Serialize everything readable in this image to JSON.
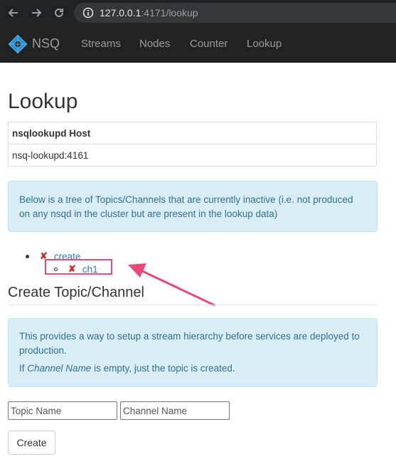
{
  "browser": {
    "url_host": "127.0.0.1",
    "url_rest": ":4171/lookup",
    "back_icon": "arrow-left-icon",
    "forward_icon": "arrow-right-icon",
    "reload_icon": "reload-icon",
    "info_icon": "info-icon"
  },
  "navbar": {
    "brand": "NSQ",
    "links": [
      "Streams",
      "Nodes",
      "Counter",
      "Lookup"
    ]
  },
  "page": {
    "title": "Lookup",
    "host_table": {
      "header": "nsqlookupd Host",
      "rows": [
        "nsq-lookupd:4161"
      ]
    },
    "inactive_alert": "Below is a tree of Topics/Channels that are currently inactive (i.e. not produced on any nsqd in the cluster but are present in the lookup data)",
    "tree": {
      "topic": "create",
      "channel": "ch1",
      "delete_mark": "✘"
    },
    "create_section": {
      "title": "Create Topic/Channel",
      "alert_line1": "This provides a way to setup a stream hierarchy before services are deployed to production.",
      "alert_line2_prefix": "If ",
      "alert_line2_em": "Channel Name",
      "alert_line2_suffix": " is empty, just the topic is created.",
      "topic_placeholder": "Topic Name",
      "channel_placeholder": "Channel Name",
      "create_button": "Create"
    }
  },
  "colors": {
    "annotation": "#e8487a",
    "alert_bg": "#d9edf7",
    "alert_text": "#31708f",
    "link": "#337ab7",
    "delete_red": "#c9302c"
  }
}
